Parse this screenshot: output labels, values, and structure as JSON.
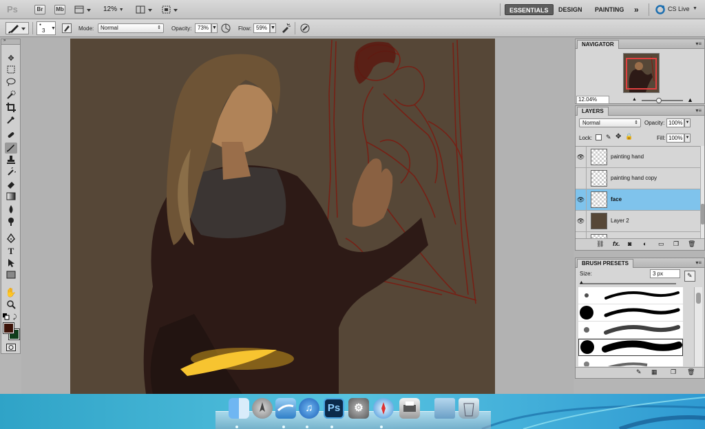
{
  "app_bar": {
    "logo": "Ps",
    "bridge_chip": "Br",
    "minibridge_chip": "Mb",
    "zoom": "12%",
    "workspaces": [
      "ESSENTIALS",
      "DESIGN",
      "PAINTING"
    ],
    "more": "»",
    "cs_live": "CS Live"
  },
  "options_bar": {
    "brush_size": "3",
    "mode_label": "Mode:",
    "mode_value": "Normal",
    "opacity_label": "Opacity:",
    "opacity_value": "73%",
    "flow_label": "Flow:",
    "flow_value": "59%"
  },
  "tools": [
    "move-tool",
    "marquee-tool",
    "lasso-tool",
    "quick-selection-tool",
    "crop-tool",
    "eyedropper-tool",
    "healing-brush-tool",
    "brush-tool",
    "clone-stamp-tool",
    "history-brush-tool",
    "eraser-tool",
    "gradient-tool",
    "blur-tool",
    "dodge-tool",
    "pen-tool",
    "type-tool",
    "path-selection-tool",
    "shape-tool",
    "hand-tool",
    "zoom-tool"
  ],
  "colors": {
    "foreground": "#3b1208",
    "background": "#0f3d1a",
    "canvas_bg": "#564737",
    "selection": "#7fc3ec"
  },
  "navigator": {
    "title": "NAVIGATOR",
    "zoom": "12.04%"
  },
  "layers": {
    "title": "LAYERS",
    "blend_mode": "Normal",
    "opacity_label": "Opacity:",
    "opacity_value": "100%",
    "lock_label": "Lock:",
    "fill_label": "Fill:",
    "fill_value": "100%",
    "items": [
      {
        "name": "painting hand",
        "visible": true,
        "selected": false
      },
      {
        "name": "painting hand copy",
        "visible": false,
        "selected": false
      },
      {
        "name": "face",
        "visible": true,
        "selected": true
      },
      {
        "name": "Layer 2",
        "visible": true,
        "selected": false
      }
    ],
    "footer_icons": [
      "link-icon",
      "fx-icon",
      "mask-icon",
      "adjustment-icon",
      "group-icon",
      "new-layer-icon",
      "trash-icon"
    ]
  },
  "brush_presets": {
    "title": "BRUSH PRESETS",
    "size_label": "Size:",
    "size_value": "3 px"
  },
  "dock": [
    "finder",
    "launchpad",
    "mail",
    "itunes",
    "Ps",
    "system-preferences",
    "safari",
    "printer",
    "folder",
    "trash"
  ]
}
